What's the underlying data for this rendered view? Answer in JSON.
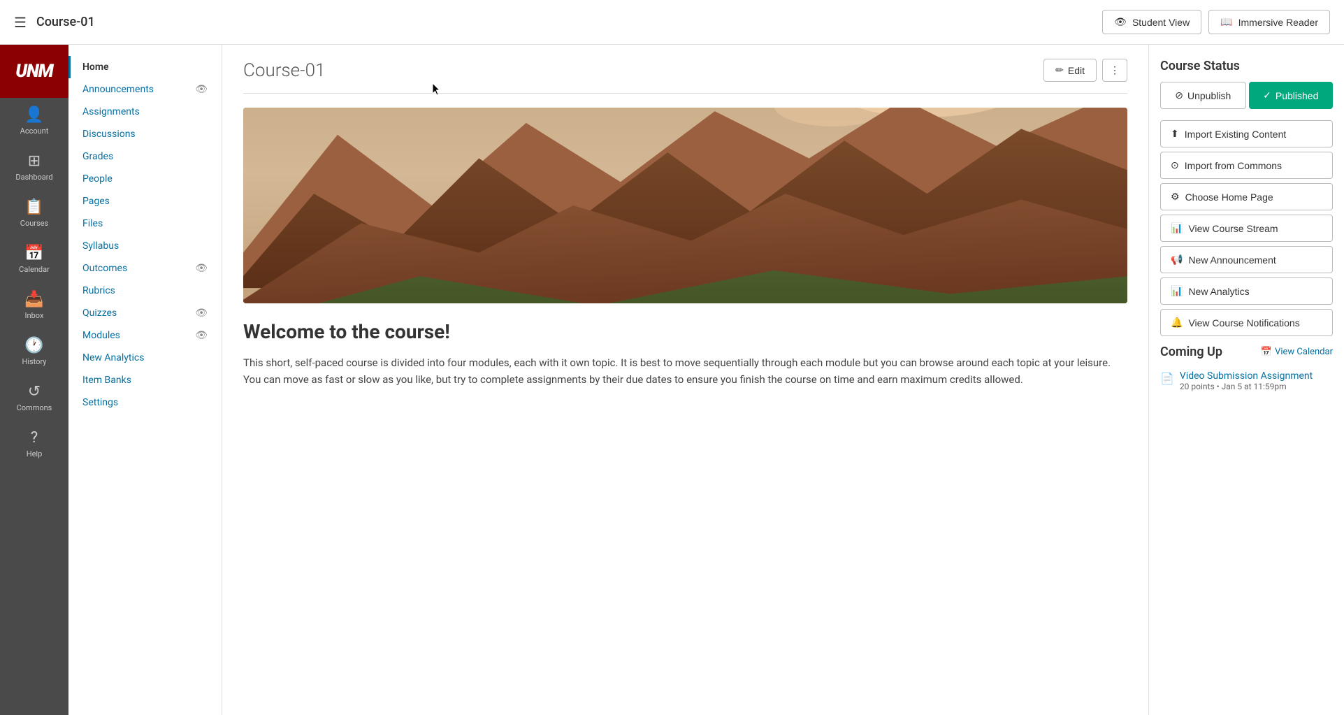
{
  "topbar": {
    "hamburger": "☰",
    "title": "Course-01",
    "student_view_label": "Student View",
    "immersive_reader_label": "Immersive Reader",
    "student_view_icon": "👁",
    "immersive_reader_icon": "📖"
  },
  "global_nav": {
    "logo": "UNM",
    "items": [
      {
        "id": "account",
        "label": "Account",
        "icon": "👤"
      },
      {
        "id": "dashboard",
        "label": "Dashboard",
        "icon": "⊞"
      },
      {
        "id": "courses",
        "label": "Courses",
        "icon": "📋"
      },
      {
        "id": "calendar",
        "label": "Calendar",
        "icon": "📅"
      },
      {
        "id": "inbox",
        "label": "Inbox",
        "icon": "📥"
      },
      {
        "id": "history",
        "label": "History",
        "icon": "🕐"
      },
      {
        "id": "commons",
        "label": "Commons",
        "icon": "↺"
      },
      {
        "id": "help",
        "label": "Help",
        "icon": "?"
      }
    ]
  },
  "course_nav": {
    "items": [
      {
        "id": "home",
        "label": "Home",
        "active": true,
        "eye": false
      },
      {
        "id": "announcements",
        "label": "Announcements",
        "active": false,
        "eye": true
      },
      {
        "id": "assignments",
        "label": "Assignments",
        "active": false,
        "eye": false
      },
      {
        "id": "discussions",
        "label": "Discussions",
        "active": false,
        "eye": false
      },
      {
        "id": "grades",
        "label": "Grades",
        "active": false,
        "eye": false
      },
      {
        "id": "people",
        "label": "People",
        "active": false,
        "eye": false
      },
      {
        "id": "pages",
        "label": "Pages",
        "active": false,
        "eye": false
      },
      {
        "id": "files",
        "label": "Files",
        "active": false,
        "eye": false
      },
      {
        "id": "syllabus",
        "label": "Syllabus",
        "active": false,
        "eye": false
      },
      {
        "id": "outcomes",
        "label": "Outcomes",
        "active": false,
        "eye": true
      },
      {
        "id": "rubrics",
        "label": "Rubrics",
        "active": false,
        "eye": false
      },
      {
        "id": "quizzes",
        "label": "Quizzes",
        "active": false,
        "eye": true
      },
      {
        "id": "modules",
        "label": "Modules",
        "active": false,
        "eye": true
      },
      {
        "id": "new-analytics",
        "label": "New Analytics",
        "active": false,
        "eye": false
      },
      {
        "id": "item-banks",
        "label": "Item Banks",
        "active": false,
        "eye": false
      },
      {
        "id": "settings",
        "label": "Settings",
        "active": false,
        "eye": false
      }
    ]
  },
  "page": {
    "title": "Course-01",
    "edit_label": "Edit",
    "more_label": "⋮",
    "welcome_heading": "Welcome to the course!",
    "welcome_body": "This short, self-paced course is divided into four modules, each with it own topic. It is best to move sequentially through each module but you can browse around each topic at your leisure. You can move as fast or slow as you like, but try to complete assignments by their due dates to ensure you finish the course on time and earn maximum credits allowed."
  },
  "right_sidebar": {
    "course_status_title": "Course Status",
    "unpublish_label": "Unpublish",
    "published_label": "Published",
    "actions": [
      {
        "id": "import-existing",
        "label": "Import Existing Content",
        "icon": "⬆"
      },
      {
        "id": "import-commons",
        "label": "Import from Commons",
        "icon": "⊙"
      },
      {
        "id": "choose-home",
        "label": "Choose Home Page",
        "icon": "⚙"
      },
      {
        "id": "view-stream",
        "label": "View Course Stream",
        "icon": "📊"
      },
      {
        "id": "new-announcement",
        "label": "New Announcement",
        "icon": "📢"
      },
      {
        "id": "new-analytics",
        "label": "New Analytics",
        "icon": "📊"
      },
      {
        "id": "view-notifications",
        "label": "View Course Notifications",
        "icon": "🔔"
      }
    ],
    "coming_up_title": "Coming Up",
    "view_calendar_label": "View Calendar",
    "coming_up_items": [
      {
        "id": "video-submission",
        "title": "Video Submission Assignment",
        "meta": "20 points • Jan 5 at 11:59pm",
        "icon": "📄"
      }
    ]
  }
}
